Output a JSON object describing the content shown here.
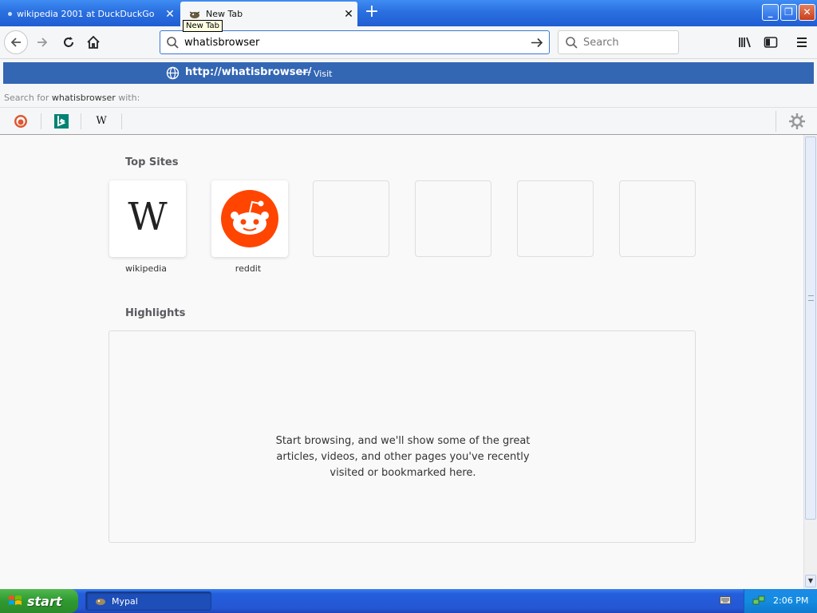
{
  "tabs": [
    {
      "label": "wikipedia 2001 at DuckDuckGo",
      "close": "✕"
    },
    {
      "label": "New Tab",
      "close": "✕"
    }
  ],
  "tooltip": "New Tab",
  "urlbar": {
    "value": "whatisbrowser"
  },
  "search": {
    "placeholder": "Search"
  },
  "suggestion": {
    "url_prefix": "http://",
    "url_domain": "whatisbrowser/",
    "dash": "—",
    "action": "Visit"
  },
  "search_for": {
    "prefix": "Search for",
    "term": "whatisbrowser",
    "suffix": "with:"
  },
  "engines": [
    {
      "name": "duckduckgo-icon"
    },
    {
      "name": "bing-icon"
    },
    {
      "name": "wikipedia-icon",
      "glyph": "W"
    }
  ],
  "newtab": {
    "top_sites_title": "Top Sites",
    "top_sites": [
      {
        "label": "wikipedia",
        "glyph": "W"
      },
      {
        "label": "reddit"
      }
    ],
    "highlights_title": "Highlights",
    "highlights_message": "Start browsing, and we'll show some of the great articles, videos, and other pages you've recently visited or bookmarked here."
  },
  "taskbar": {
    "start_label": "start",
    "task_label": "Mypal",
    "clock": "2:06 PM"
  },
  "colors": {
    "accent": "#3366b3",
    "reddit": "#ff4500",
    "titlebar": "#2a6fe0"
  }
}
